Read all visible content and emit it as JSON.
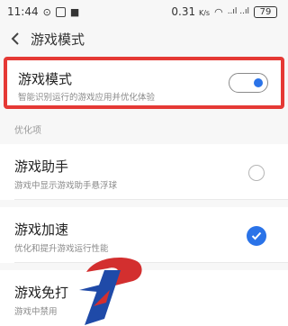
{
  "status_bar": {
    "time": "11:44",
    "network_speed": "0.31",
    "speed_unit": "K/s",
    "signal_text": "..ıl ..ıl",
    "battery": "79"
  },
  "header": {
    "title": "游戏模式"
  },
  "game_mode": {
    "title": "游戏模式",
    "subtitle": "智能识别运行的游戏应用并优化体验",
    "enabled": true,
    "accent_color": "#2a73e8",
    "highlight_color": "#e53935"
  },
  "section": {
    "label": "优化项"
  },
  "options": [
    {
      "title": "游戏助手",
      "subtitle": "游戏中显示游戏助手悬浮球",
      "checked": false
    },
    {
      "title": "游戏加速",
      "subtitle": "优化和提升游戏运行性能",
      "checked": true
    },
    {
      "title": "游戏免打",
      "subtitle": "游戏中禁用",
      "checked": false
    }
  ],
  "icons": {
    "logo": "stylized-p-logo-red-blue"
  }
}
